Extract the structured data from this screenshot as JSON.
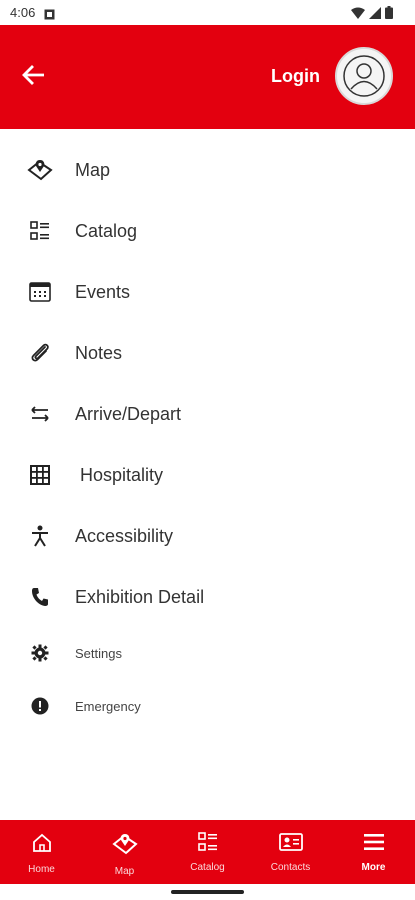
{
  "status_bar": {
    "time": "4:06"
  },
  "header": {
    "login_label": "Login"
  },
  "menu": {
    "items": [
      {
        "label": "Map",
        "icon": "map-icon"
      },
      {
        "label": "Catalog",
        "icon": "catalog-icon"
      },
      {
        "label": "Events",
        "icon": "calendar-icon"
      },
      {
        "label": "Notes",
        "icon": "paperclip-icon"
      },
      {
        "label": "Arrive/Depart",
        "icon": "arrows-icon"
      },
      {
        "label": "Hospitality",
        "icon": "building-icon"
      },
      {
        "label": "Accessibility",
        "icon": "accessibility-icon"
      },
      {
        "label": "Exhibition Detail",
        "icon": "phone-icon"
      },
      {
        "label": "Settings",
        "icon": "gear-icon"
      },
      {
        "label": "Emergency",
        "icon": "alert-icon"
      }
    ]
  },
  "bottom_nav": {
    "items": [
      {
        "label": "Home",
        "icon": "home-icon"
      },
      {
        "label": "Map",
        "icon": "map-icon"
      },
      {
        "label": "Catalog",
        "icon": "catalog-icon"
      },
      {
        "label": "Contacts",
        "icon": "contact-card-icon"
      },
      {
        "label": "More",
        "icon": "menu-icon",
        "active": true
      }
    ]
  },
  "colors": {
    "brand": "#e3000f",
    "text": "#333333",
    "background": "#ffffff"
  }
}
